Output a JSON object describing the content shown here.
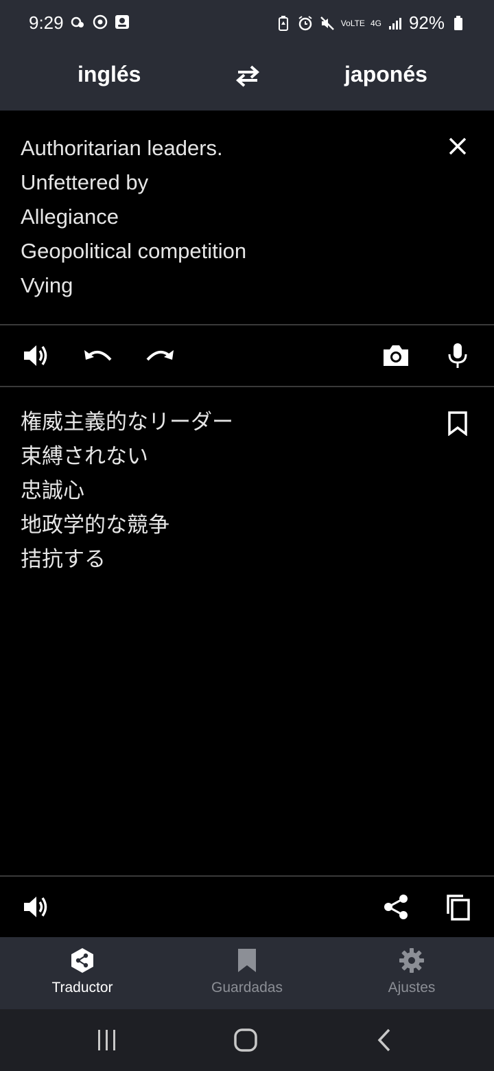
{
  "status_bar": {
    "time": "9:29",
    "battery_percent": "92%",
    "network_label": "4G",
    "volte_label": "VoLTE"
  },
  "language_bar": {
    "source": "inglés",
    "target": "japonés"
  },
  "input": {
    "lines": [
      "Authoritarian leaders.",
      "Unfettered by",
      "Allegiance",
      "Geopolitical competition",
      "Vying"
    ]
  },
  "output": {
    "lines": [
      "権威主義的なリーダー",
      "束縛されない",
      "忠誠心",
      "地政学的な競争",
      "拮抗する"
    ]
  },
  "bottom_nav": {
    "items": [
      {
        "label": "Traductor",
        "icon": "translator-icon",
        "active": true
      },
      {
        "label": "Guardadas",
        "icon": "bookmark-icon",
        "active": false
      },
      {
        "label": "Ajustes",
        "icon": "gear-icon",
        "active": false
      }
    ]
  },
  "colors": {
    "bar_bg": "#2a2d36",
    "content_bg": "#000000",
    "active": "#ffffff",
    "inactive": "#8c8f96"
  }
}
